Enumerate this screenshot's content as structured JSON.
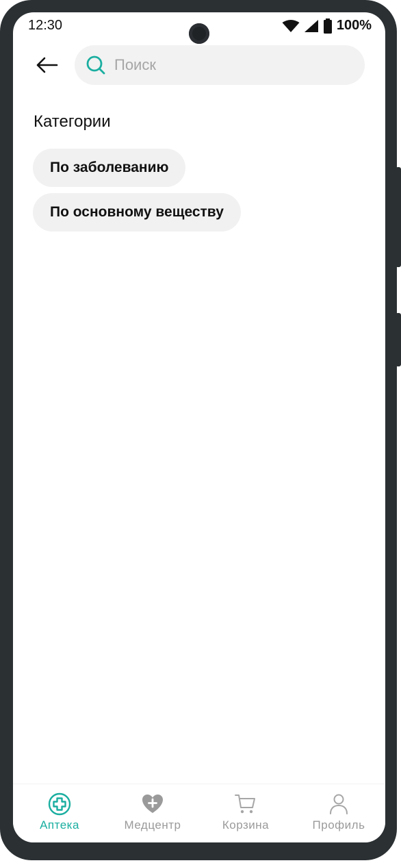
{
  "status_bar": {
    "time": "12:30",
    "battery": "100%"
  },
  "search": {
    "placeholder": "Поиск",
    "value": ""
  },
  "categories": {
    "title": "Категории",
    "items": [
      {
        "label": "По заболеванию"
      },
      {
        "label": "По основному веществу"
      }
    ]
  },
  "bottom_nav": {
    "active": "Аптека",
    "items": [
      {
        "label": "Аптека",
        "icon": "pharmacy-cross-icon"
      },
      {
        "label": "Медцентр",
        "icon": "heart-plus-icon"
      },
      {
        "label": "Корзина",
        "icon": "cart-icon"
      },
      {
        "label": "Профиль",
        "icon": "user-icon"
      }
    ]
  },
  "colors": {
    "accent": "#1aaea0",
    "chip_bg": "#f1f1f1",
    "search_bg": "#f2f2f2",
    "inactive": "#9a9a9a"
  }
}
